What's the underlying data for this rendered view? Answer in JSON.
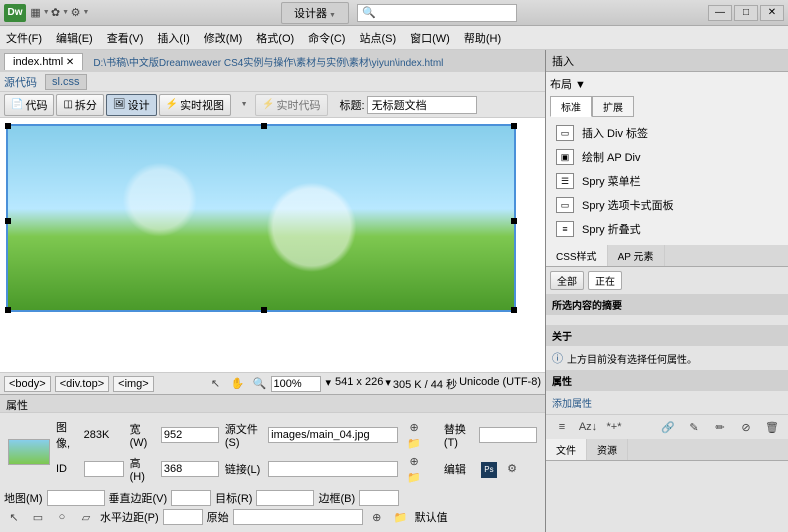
{
  "titlebar": {
    "logo": "Dw",
    "designer": "设计器",
    "search_placeholder": ""
  },
  "menu": [
    "文件(F)",
    "编辑(E)",
    "查看(V)",
    "插入(I)",
    "修改(M)",
    "格式(O)",
    "命令(C)",
    "站点(S)",
    "窗口(W)",
    "帮助(H)"
  ],
  "tabs": {
    "active": "index.html",
    "path": "D:\\书稿\\中文版Dreamweaver CS4实例与操作\\素材与实例\\素材\\yiyun\\index.html"
  },
  "subtabs": {
    "source": "源代码",
    "css": "sl.css"
  },
  "toolbar": {
    "code": "代码",
    "split": "拆分",
    "design": "设计",
    "live_view": "实时视图",
    "live_code": "实时代码",
    "title_label": "标题:",
    "title_value": "无标题文档"
  },
  "status": {
    "tags": [
      "<body>",
      "<div.top>",
      "<img>"
    ],
    "zoom": "100%",
    "dims": "541 x 226",
    "size": "305 K / 44 秒",
    "encoding": "Unicode (UTF-8)"
  },
  "props": {
    "header": "属性",
    "image_label": "图像,",
    "image_size": "283K",
    "width_label": "宽(W)",
    "width": "952",
    "height_label": "高(H)",
    "height": "368",
    "id_label": "ID",
    "id": "",
    "src_label": "源文件(S)",
    "src": "images/main_04.jpg",
    "link_label": "链接(L)",
    "link": "",
    "alt_label": "替换(T)",
    "alt": "",
    "edit_label": "编辑",
    "map_label": "地图(M)",
    "vspace_label": "垂直边距(V)",
    "target_label": "目标(R)",
    "border_label": "边框(B)",
    "hspace_label": "水平边距(P)",
    "original_label": "原始",
    "align_label": "默认值"
  },
  "insert_panel": {
    "title": "插入",
    "group": "布局",
    "options": [
      "标准",
      "扩展"
    ],
    "items": [
      "插入 Div 标签",
      "绘制 AP Div",
      "Spry 菜单栏",
      "Spry 选项卡式面板",
      "Spry 折叠式"
    ]
  },
  "css_panel": {
    "tabs": [
      "CSS样式",
      "AP 元素"
    ],
    "all": "全部",
    "current": "正在",
    "summary": "所选内容的摘要",
    "about": "关于",
    "msg": "上方目前没有选择任何属性。"
  },
  "attrs_panel": {
    "title": "属性",
    "add": "添加属性"
  },
  "bottom_tabs": [
    "文件",
    "资源"
  ]
}
